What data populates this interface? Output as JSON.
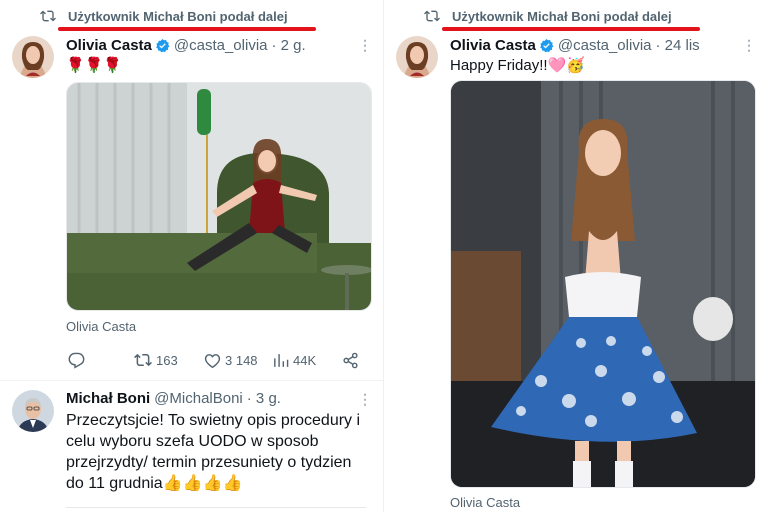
{
  "left": {
    "repost": {
      "text": "Użytkownik Michał Boni podał dalej"
    },
    "tweet": {
      "name": "Olivia Casta",
      "handle": "@casta_olivia",
      "time": "· 2 g.",
      "text": "🌹🌹🌹",
      "media_caption": "Olivia Casta",
      "counts": {
        "retweets": "163",
        "likes": "3 148",
        "views": "44K"
      }
    },
    "reply": {
      "name": "Michał Boni",
      "handle": "@MichalBoni",
      "time": "· 3 g.",
      "text": "Przeczytsjcie! To swietny opis procedury i celu wyboru szefa UODO w sposob przejrzydty/ termin przesuniety o tydzien do 11 grudnia👍👍👍👍"
    }
  },
  "right": {
    "repost": {
      "text": "Użytkownik Michał Boni podał dalej"
    },
    "tweet": {
      "name": "Olivia Casta",
      "handle": "@casta_olivia",
      "time": "· 24 lis",
      "text": "Happy Friday!!🩷🥳",
      "media_caption": "Olivia Casta"
    }
  },
  "colors": {
    "verified": "#1d9bf0",
    "highlight": "#e3131b",
    "muted": "#536471"
  },
  "icons": [
    "repost-icon",
    "verified-badge-icon",
    "more-icon",
    "reply-icon",
    "retweet-icon",
    "like-icon",
    "views-icon",
    "share-icon"
  ]
}
